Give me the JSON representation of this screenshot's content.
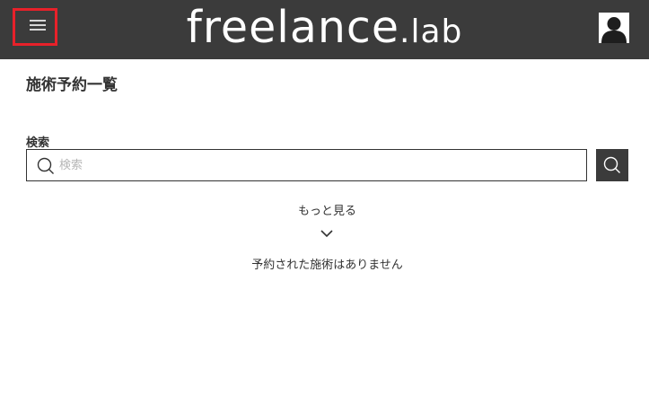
{
  "header": {
    "logo_main": "freelance",
    "logo_sub": ".lab",
    "colors": {
      "background": "#3b3b3b",
      "menu_highlight": "#e8212a"
    },
    "menu_icon": "hamburger-menu-icon",
    "avatar_icon": "user-avatar-icon"
  },
  "page": {
    "title": "施術予約一覧"
  },
  "search": {
    "label": "検索",
    "placeholder": "検索",
    "value": "",
    "icon": "search-icon",
    "button_icon": "search-icon"
  },
  "more": {
    "label": "もっと見る",
    "icon": "chevron-down-icon"
  },
  "empty_message": "予約された施術はありません"
}
